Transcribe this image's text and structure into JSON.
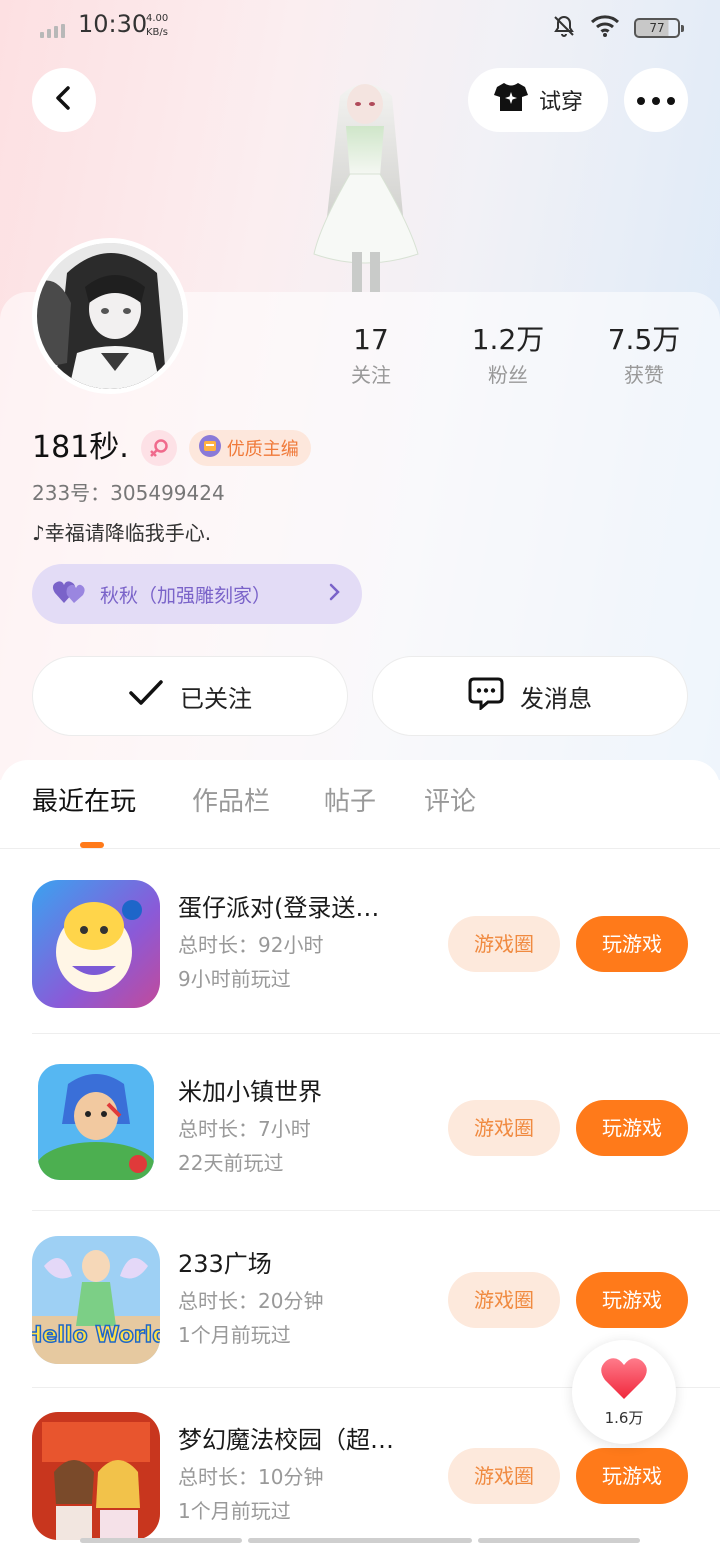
{
  "status_bar": {
    "time": "10:30",
    "net_speed_value": "4.00",
    "net_speed_unit": "KB/s",
    "battery": "77"
  },
  "header": {
    "back_icon": "chevron-left-icon",
    "tryon_label": "试穿",
    "more_icon": "more-horizontal-icon"
  },
  "profile": {
    "nickname": "181秒.",
    "quality_badge": "优质主编",
    "user_id": "233号：305499424",
    "bio": "♪幸福请降临我手心.",
    "tag_chip": "秋秋（加强雕刻家）",
    "stats": [
      {
        "value": "17",
        "label": "关注"
      },
      {
        "value": "1.2万",
        "label": "粉丝"
      },
      {
        "value": "7.5万",
        "label": "获赞"
      }
    ]
  },
  "actions": {
    "follow_label": "已关注",
    "message_label": "发消息"
  },
  "tabs": [
    "最近在玩",
    "作品栏",
    "帖子",
    "评论"
  ],
  "games": [
    {
      "name": "蛋仔派对(登录送…",
      "duration": "总时长：92小时",
      "last_played": "9小时前玩过",
      "circle_label": "游戏圈",
      "play_label": "玩游戏"
    },
    {
      "name": "米加小镇世界",
      "duration": "总时长：7小时",
      "last_played": "22天前玩过",
      "circle_label": "游戏圈",
      "play_label": "玩游戏"
    },
    {
      "name": "233广场",
      "duration": "总时长：20分钟",
      "last_played": "1个月前玩过",
      "circle_label": "游戏圈",
      "play_label": "玩游戏"
    },
    {
      "name": "梦幻魔法校园（超…",
      "duration": "总时长：10分钟",
      "last_played": "1个月前玩过",
      "circle_label": "游戏圈",
      "play_label": "玩游戏"
    }
  ],
  "game_icon_texts": {
    "hello_world": "Hello World"
  },
  "like_float": {
    "count": "1.6万"
  },
  "colors": {
    "accent": "#ff7a1a",
    "accent_light": "#fde9dc",
    "chip_bg": "#e3dcf6",
    "chip_text": "#7a63c9"
  }
}
